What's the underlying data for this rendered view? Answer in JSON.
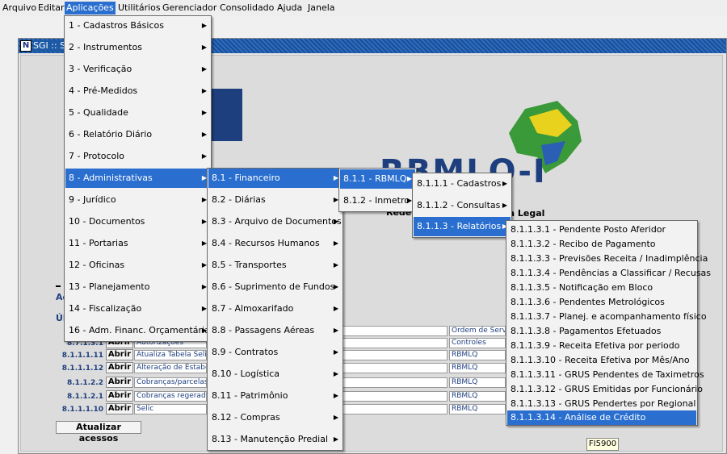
{
  "menubar": {
    "items": [
      "Arquivo",
      "Editar",
      "Aplicações",
      "Utilitários",
      "Gerenciador",
      "Consolidado",
      "Ajuda",
      "Janela"
    ],
    "active": "Aplicações"
  },
  "window": {
    "title": "SGI :: Si"
  },
  "banner": {
    "logo": "RBMLQ-I",
    "sub1": "Rede",
    "sub2": "gia Legal"
  },
  "labels": {
    "acessos": "Ac",
    "ultimos": "Úl",
    "atualizar": "Atualizar acessos",
    "status": "FI5900"
  },
  "recent_rows": [
    {
      "code": "8.7.1.3.1",
      "action": "Abrir",
      "desc": "Autorizações",
      "module": "Controles"
    },
    {
      "code": "8.1.1.1.11",
      "action": "Abrir",
      "desc": "Atualiza Tabela Selic",
      "module": "RBMLQ"
    },
    {
      "code": "8.1.1.1.12",
      "action": "Abrir",
      "desc": "Alteração de Estabe",
      "module": "RBMLQ"
    },
    {
      "code": "8.1.1.2.2",
      "action": "Abrir",
      "desc": "Cobranças/parcelas",
      "module": "RBMLQ"
    },
    {
      "code": "8.1.1.2.1",
      "action": "Abrir",
      "desc": "Cobranças regerad",
      "module": "RBMLQ"
    },
    {
      "code": "8.1.1.1.10",
      "action": "Abrir",
      "desc": "Selic",
      "module": "RBMLQ"
    }
  ],
  "top_module": "Ordem de Serv",
  "menu1": [
    "1 - Cadastros Básicos",
    "2 - Instrumentos",
    "3 - Verificação",
    "4 - Pré-Medidos",
    "5 - Qualidade",
    "6 - Relatório Diário",
    "7 - Protocolo",
    "8 - Administrativas",
    "9 - Jurídico",
    "10 - Documentos",
    "11 - Portarias",
    "12 - Oficinas",
    "13 - Planejamento",
    "14 - Fiscalização",
    "16 - Adm. Financ. Orçamentária"
  ],
  "menu2": [
    "8.1 - Financeiro",
    "8.2 - Diárias",
    "8.3 - Arquivo de Documentos",
    "8.4 - Recursos Humanos",
    "8.5 - Transportes",
    "8.6 - Suprimento de Fundos",
    "8.7 - Almoxarifado",
    "8.8 - Passagens Aéreas",
    "8.9 - Contratos",
    "8.10 - Logística",
    "8.11 - Patrimônio",
    "8.12 - Compras",
    "8.13 - Manutenção Predial"
  ],
  "menu3": [
    "8.1.1 - RBMLQ",
    "8.1.2 - Inmetro"
  ],
  "menu4": [
    "8.1.1.1 - Cadastros",
    "8.1.1.2 - Consultas",
    "8.1.1.3 - Relatórios"
  ],
  "menu5": [
    "8.1.1.3.1 - Pendente Posto Aferidor",
    "8.1.1.3.2 - Recibo de Pagamento",
    "8.1.1.3.3 - Previsões Receita / Inadimplência",
    "8.1.1.3.4 - Pendências a Classificar / Recusas",
    "8.1.1.3.5 - Notificação em Bloco",
    "8.1.1.3.6 - Pendentes Metrológicos",
    "8.1.1.3.7 - Planej. e acompanhamento físico",
    "8.1.1.3.8 - Pagamentos Efetuados",
    "8.1.1.3.9 - Receita Efetiva por periodo",
    "8.1.1.3.10 - Receita Efetiva por Mês/Ano",
    "8.1.1.3.11 - GRUS Pendentes de Taximetros",
    "8.1.1.3.12 - GRUS Emitidas por Funcionário",
    "8.1.1.3.13 - GRUS Pendertes por Regional",
    "8.1.1.3.14 - Análise de Crédito"
  ],
  "colors": {
    "accent": "#2a6fcf",
    "brand": "#1e3f7e"
  }
}
